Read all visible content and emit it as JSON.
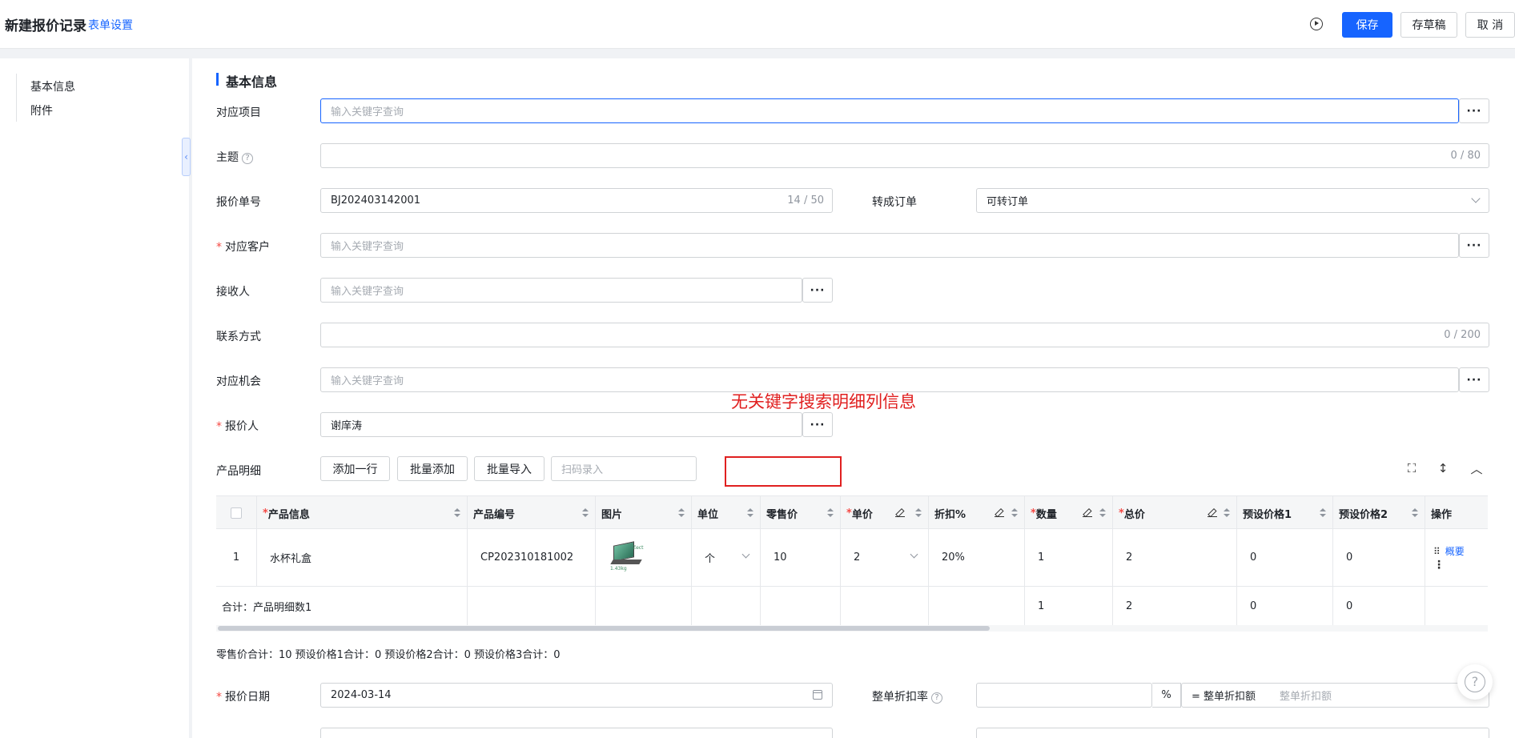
{
  "header": {
    "title": "新建报价记录",
    "form_settings": "表单设置",
    "save": "保存",
    "draft": "存草稿",
    "cancel": "取 消"
  },
  "leftnav": {
    "items": [
      "基本信息",
      "附件"
    ]
  },
  "section_title": "基本信息",
  "fields": {
    "project": {
      "label": "对应项目",
      "placeholder": "输入关键字查询"
    },
    "subject": {
      "label": "主题",
      "count": "0 / 80"
    },
    "quote_no": {
      "label": "报价单号",
      "value": "BJ202403142001",
      "count": "14 / 50"
    },
    "convert_order": {
      "label": "转成订单",
      "value": "可转订单"
    },
    "customer": {
      "label": "对应客户",
      "placeholder": "输入关键字查询"
    },
    "receiver": {
      "label": "接收人",
      "placeholder": "输入关键字查询"
    },
    "contact": {
      "label": "联系方式",
      "count": "0 / 200"
    },
    "opportunity": {
      "label": "对应机会",
      "placeholder": "输入关键字查询"
    },
    "quoter": {
      "label": "报价人",
      "value": "谢庠涛"
    },
    "quote_date": {
      "label": "报价日期",
      "value": "2024-03-14"
    },
    "discount_rate": {
      "label": "整单折扣率",
      "unit": "%",
      "eq_label": "= 整单折扣额",
      "eq_placeholder": "整单折扣额"
    }
  },
  "annotation": "无关键字搜索明细列信息",
  "product_detail": {
    "label": "产品明细",
    "add_row": "添加一行",
    "batch_add": "批量添加",
    "batch_import": "批量导入",
    "scan_placeholder": "扫码录入"
  },
  "table": {
    "headers": [
      "产品信息",
      "产品编号",
      "图片",
      "单位",
      "零售价",
      "单价",
      "折扣%",
      "数量",
      "总价",
      "预设价格1",
      "预设价格2",
      "操作"
    ],
    "row": {
      "index": "1",
      "product": "水杯礼盒",
      "code": "CP202310181002",
      "unit": "个",
      "retail": "10",
      "price": "2",
      "discount": "20%",
      "qty": "1",
      "total": "2",
      "preset1": "0",
      "preset2": "0",
      "action": "概要",
      "thumb_text1": "Zect",
      "thumb_text2": "1.43kg"
    },
    "summary": {
      "label": "合计：产品明细数1",
      "qty": "1",
      "total": "2",
      "preset1": "0",
      "preset2": "0"
    }
  },
  "totals_line": "零售价合计：10  预设价格1合计：0  预设价格2合计：0  预设价格3合计：0"
}
